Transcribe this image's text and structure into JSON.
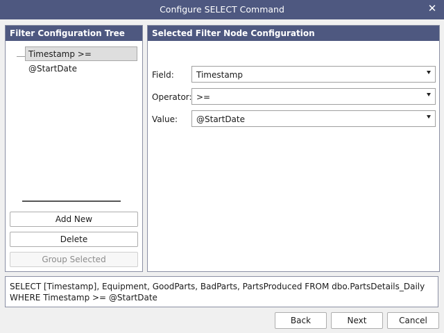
{
  "window": {
    "title": "Configure SELECT Command"
  },
  "tree_panel": {
    "title": "Filter Configuration Tree",
    "nodes": [
      "Timestamp >= @StartDate"
    ],
    "buttons": {
      "add_new": "Add New",
      "delete": "Delete",
      "group_selected": "Group Selected"
    }
  },
  "config_panel": {
    "title": "Selected Filter Node Configuration",
    "field": {
      "label": "Field:",
      "value": "Timestamp"
    },
    "operator": {
      "label": "Operator:",
      "value": ">="
    },
    "value": {
      "label": "Value:",
      "value": "@StartDate"
    }
  },
  "sql_preview": "SELECT [Timestamp], Equipment, GoodParts, BadParts, PartsProduced FROM dbo.PartsDetails_Daily WHERE Timestamp >= @StartDate",
  "footer": {
    "back": "Back",
    "next": "Next",
    "cancel": "Cancel"
  },
  "colors": {
    "header": "#4e5880"
  }
}
